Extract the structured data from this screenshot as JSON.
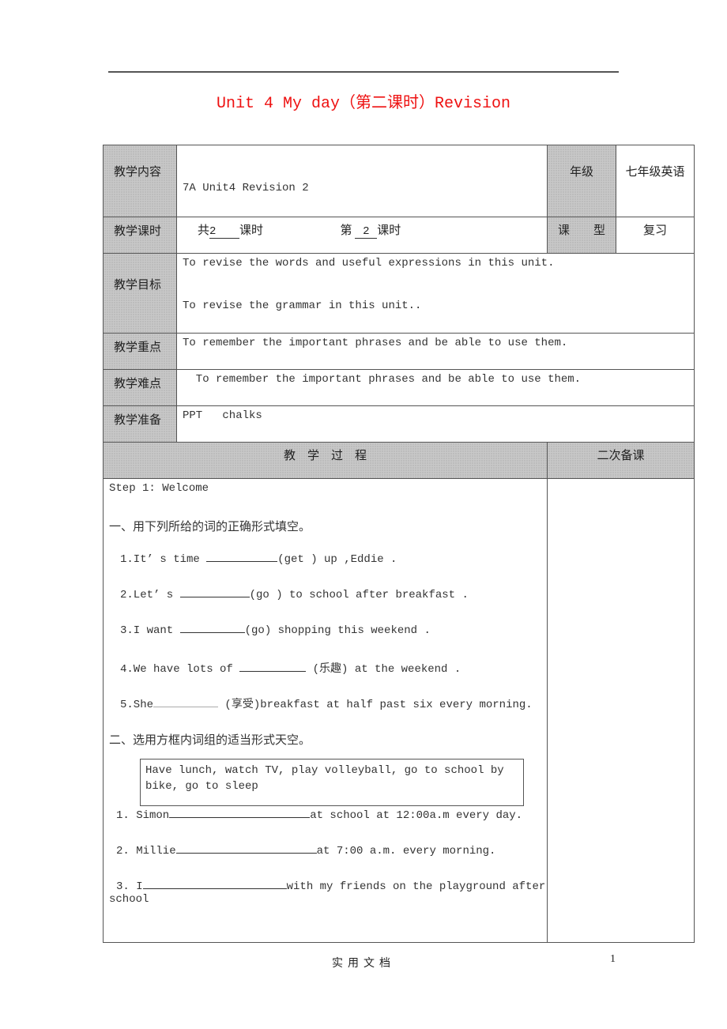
{
  "document": {
    "title": "Unit 4 My day（第二课时）Revision",
    "title_color": "#ee1111",
    "footer": {
      "center": "实用文档",
      "page_number": "1"
    }
  },
  "info_table": {
    "content": {
      "label": "教学内容",
      "value": "7A   Unit4   Revision 2"
    },
    "grade": {
      "label": "年级",
      "value": "七年级英语"
    },
    "periods": {
      "label": "教学课时",
      "total_prefix": "共",
      "total": "2",
      "total_suffix": "课时",
      "current_prefix": "第",
      "current": "2",
      "current_suffix": "课时"
    },
    "lesson_type": {
      "label": "课　　型",
      "value": "复习"
    },
    "objectives": {
      "label": "教学目标",
      "lines": [
        "To revise the words and useful expressions in this unit.",
        "To revise the grammar in this unit.."
      ]
    },
    "key_points": {
      "label": "教学重点",
      "value": "To remember the important phrases and be able to use them."
    },
    "difficulties": {
      "label": "教学难点",
      "value": "  To remember the important phrases and be able to use them."
    },
    "preparation": {
      "label": "教学准备",
      "value": "PPT   chalks"
    }
  },
  "process": {
    "header_left": "教　学　过　程",
    "header_right": "二次备课",
    "step": "Step 1: Welcome",
    "section1": {
      "instruction": "一、用下列所给的词的正确形式填空。",
      "items": [
        {
          "before": "1.It’ s time ",
          "after": "(get ) up ,Eddie ."
        },
        {
          "before": "2.Let’ s ",
          "after": "(go ) to school after breakfast ."
        },
        {
          "before": "3.I want ",
          "after": "(go) shopping this weekend ."
        },
        {
          "before": "4.We have lots of ",
          "after": "  (乐趣) at the weekend ."
        },
        {
          "before": "5.She",
          "after": " (享受)breakfast at half past six every morning."
        }
      ]
    },
    "section2": {
      "instruction": "二、选用方框内词组的适当形式天空。",
      "word_box": "Have lunch, watch TV, play volleyball, go to school by bike, go to sleep",
      "items": [
        {
          "before": "1. Simon",
          "after": "at school at 12:00a.m every day."
        },
        {
          "before": "2. Millie",
          "after": "at 7:00 a.m. every morning."
        },
        {
          "before": "3. I",
          "after": "with my friends on the playground after",
          "continuation": "school"
        }
      ]
    }
  }
}
